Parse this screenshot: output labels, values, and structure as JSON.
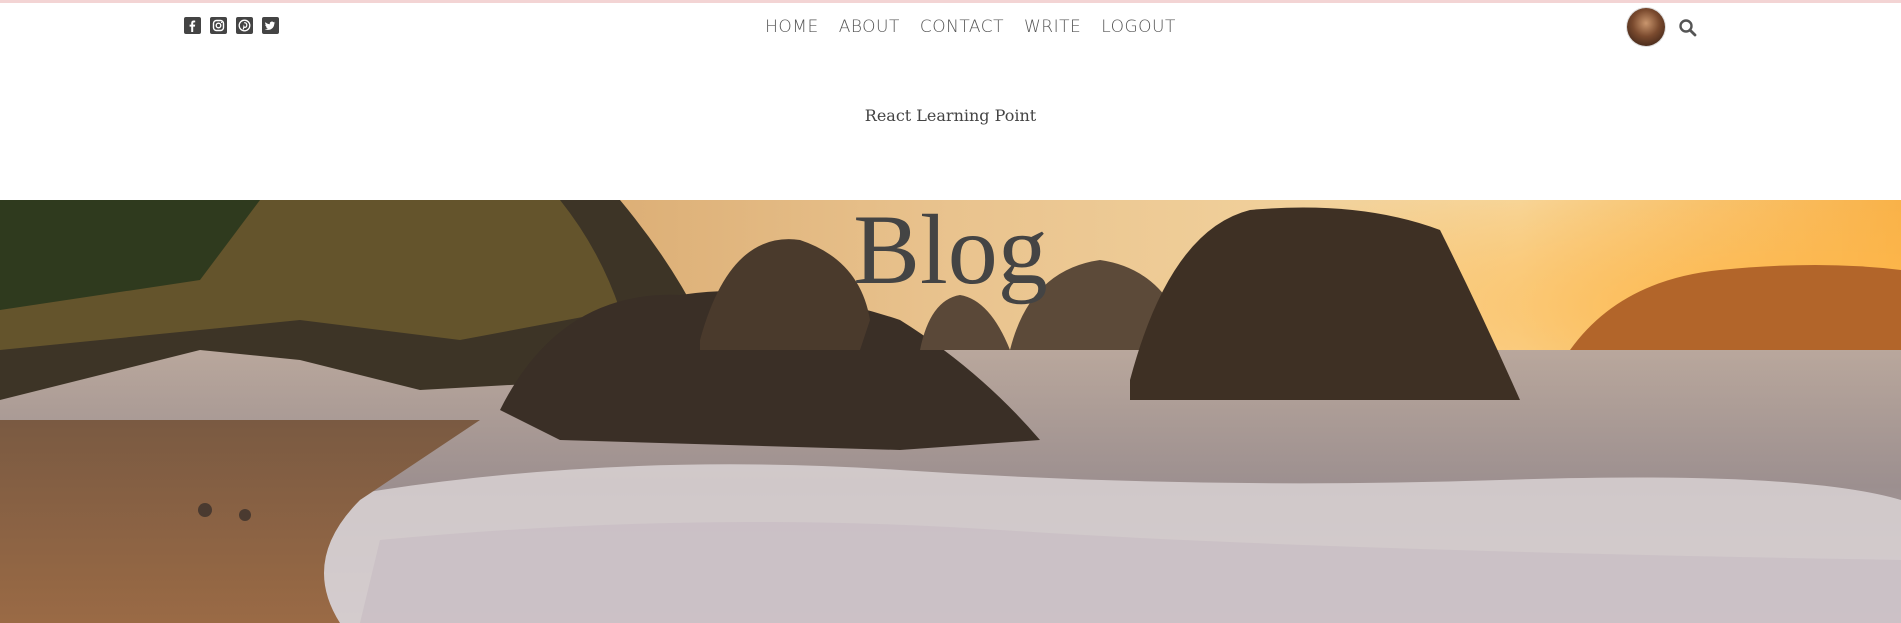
{
  "social": {
    "icons": [
      "facebook-square-icon",
      "instagram-square-icon",
      "pinterest-square-icon",
      "twitter-square-icon"
    ]
  },
  "nav": {
    "items": [
      "HOME",
      "ABOUT",
      "CONTACT",
      "WRITE",
      "LOGOUT"
    ]
  },
  "header": {
    "subtitle": "React Learning Point"
  },
  "hero": {
    "title": "Blog"
  },
  "colors": {
    "top_line": "#f3d4d4",
    "text": "#444444"
  }
}
